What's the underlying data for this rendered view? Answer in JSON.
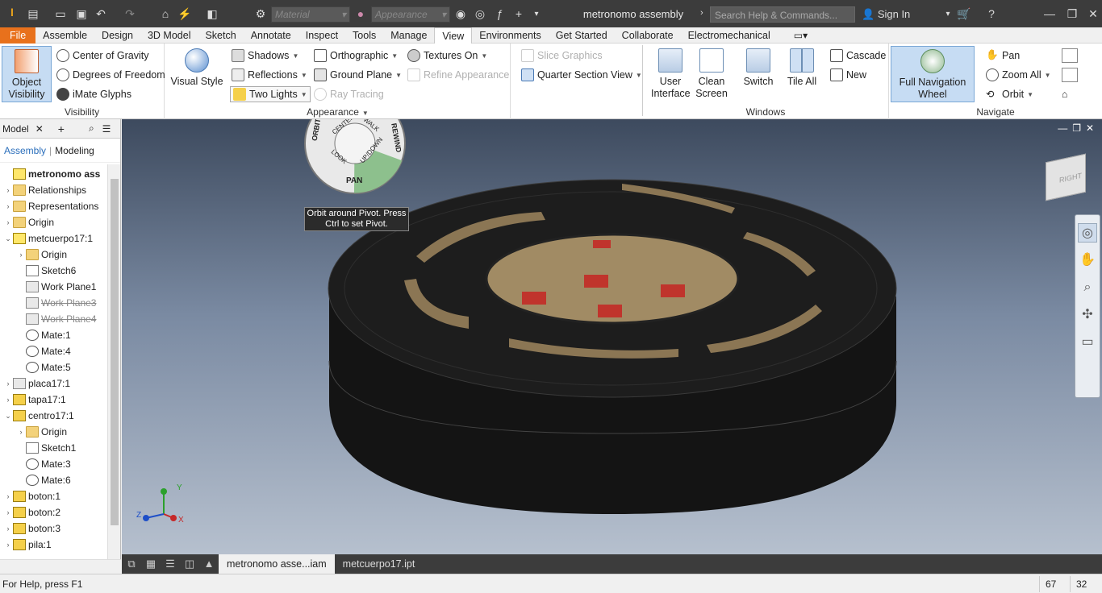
{
  "titlebar": {
    "material_placeholder": "Material",
    "appearance_placeholder": "Appearance",
    "title": "metronomo assembly",
    "search_placeholder": "Search Help & Commands...",
    "sign_in": "Sign In"
  },
  "menu": {
    "tabs": [
      "File",
      "Assemble",
      "Design",
      "3D Model",
      "Sketch",
      "Annotate",
      "Inspect",
      "Tools",
      "Manage",
      "View",
      "Environments",
      "Get Started",
      "Collaborate",
      "Electromechanical"
    ],
    "active": "View"
  },
  "ribbon": {
    "visibility": {
      "label": "Visibility",
      "object_visibility": "Object Visibility",
      "center_of_gravity": "Center of Gravity",
      "degrees_of_freedom": "Degrees of Freedom",
      "imate_glyphs": "iMate Glyphs"
    },
    "appearance": {
      "label": "Appearance",
      "visual_style": "Visual Style",
      "shadows": "Shadows",
      "reflections": "Reflections",
      "two_lights": "Two Lights",
      "orthographic": "Orthographic",
      "ground_plane": "Ground Plane",
      "ray_tracing": "Ray Tracing",
      "textures_on": "Textures On",
      "refine_appearance": "Refine Appearance",
      "slice_graphics": "Slice Graphics",
      "quarter_section_view": "Quarter Section View"
    },
    "windows": {
      "label": "Windows",
      "user_interface": "User Interface",
      "clean_screen": "Clean Screen",
      "switch": "Switch",
      "tile_all": "Tile All",
      "cascade": "Cascade",
      "new": "New"
    },
    "navigate": {
      "label": "Navigate",
      "full_navigation_wheel": "Full Navigation Wheel",
      "pan": "Pan",
      "zoom_all": "Zoom All",
      "orbit": "Orbit"
    }
  },
  "browser": {
    "tab": "Model",
    "sub_assembly": "Assembly",
    "sub_modeling": "Modeling",
    "tree": [
      {
        "label": "metronomo ass",
        "icon": "asm",
        "level": 0,
        "bold": true,
        "tw": ""
      },
      {
        "label": "Relationships",
        "icon": "folder",
        "level": 0,
        "tw": "›"
      },
      {
        "label": "Representations",
        "icon": "folder",
        "level": 0,
        "tw": "›"
      },
      {
        "label": "Origin",
        "icon": "folder",
        "level": 0,
        "tw": "›"
      },
      {
        "label": "metcuerpo17:1",
        "icon": "asm",
        "level": 0,
        "tw": "⌄"
      },
      {
        "label": "Origin",
        "icon": "folder",
        "level": 1,
        "tw": "›"
      },
      {
        "label": "Sketch6",
        "icon": "sketch",
        "level": 1,
        "tw": ""
      },
      {
        "label": "Work Plane1",
        "icon": "plane",
        "level": 1,
        "tw": ""
      },
      {
        "label": "Work Plane3",
        "icon": "plane",
        "level": 1,
        "tw": "",
        "strike": true
      },
      {
        "label": "Work Plane4",
        "icon": "plane",
        "level": 1,
        "tw": "",
        "strike": true
      },
      {
        "label": "Mate:1",
        "icon": "mate",
        "level": 1,
        "tw": ""
      },
      {
        "label": "Mate:4",
        "icon": "mate",
        "level": 1,
        "tw": ""
      },
      {
        "label": "Mate:5",
        "icon": "mate",
        "level": 1,
        "tw": ""
      },
      {
        "label": "placa17:1",
        "icon": "plane",
        "level": 0,
        "tw": "›"
      },
      {
        "label": "tapa17:1",
        "icon": "part",
        "level": 0,
        "tw": "›"
      },
      {
        "label": "centro17:1",
        "icon": "part",
        "level": 0,
        "tw": "⌄"
      },
      {
        "label": "Origin",
        "icon": "folder",
        "level": 1,
        "tw": "›"
      },
      {
        "label": "Sketch1",
        "icon": "sketch",
        "level": 1,
        "tw": ""
      },
      {
        "label": "Mate:3",
        "icon": "mate",
        "level": 1,
        "tw": ""
      },
      {
        "label": "Mate:6",
        "icon": "mate",
        "level": 1,
        "tw": ""
      },
      {
        "label": "boton:1",
        "icon": "part",
        "level": 0,
        "tw": "›"
      },
      {
        "label": "boton:2",
        "icon": "part",
        "level": 0,
        "tw": "›"
      },
      {
        "label": "boton:3",
        "icon": "part",
        "level": 0,
        "tw": "›"
      },
      {
        "label": "pila:1",
        "icon": "part",
        "level": 0,
        "tw": "›"
      }
    ]
  },
  "viewport": {
    "tooltip": "Orbit around Pivot. Press Ctrl to set Pivot.",
    "wheel": {
      "orbit": "ORBIT",
      "center": "CENTER",
      "walk": "WALK",
      "rewind": "REWIND",
      "look": "LOOK",
      "updown": "UP/DOWN",
      "pan": "PAN"
    },
    "viewcube_face": "RIGHT",
    "axes": {
      "x": "X",
      "y": "Y",
      "z": "Z"
    }
  },
  "doctabs": [
    "metronomo asse...iam",
    "metcuerpo17.ipt"
  ],
  "status": {
    "help": "For Help, press F1",
    "a": "67",
    "b": "32"
  }
}
